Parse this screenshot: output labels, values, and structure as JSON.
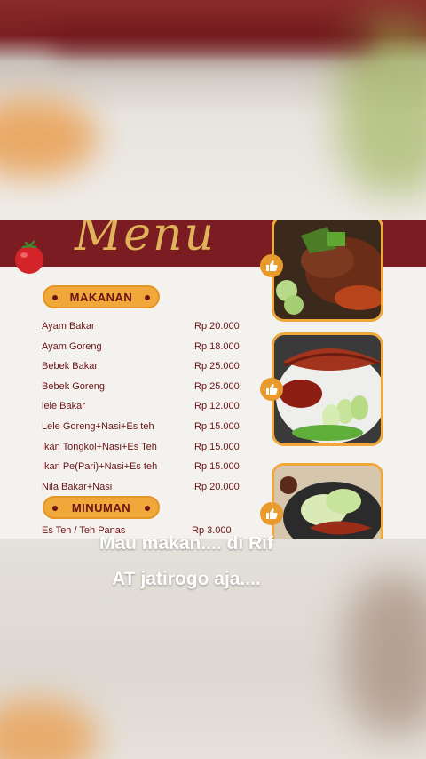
{
  "menu": {
    "title": "Menu",
    "sections": {
      "makanan": "MAKANAN",
      "minuman": "MINUMAN"
    },
    "makanan_items": [
      {
        "name": "Ayam Bakar",
        "price": "Rp 20.000"
      },
      {
        "name": "Ayam Goreng",
        "price": "Rp 18.000"
      },
      {
        "name": "Bebek Bakar",
        "price": "Rp 25.000"
      },
      {
        "name": "Bebek Goreng",
        "price": "Rp 25.000"
      },
      {
        "name": "lele Bakar",
        "price": "Rp 12.000"
      },
      {
        "name": "Lele Goreng+Nasi+Es teh",
        "price": "Rp 15.000"
      },
      {
        "name": "Ikan Tongkol+Nasi+Es Teh",
        "price": "Rp 15.000"
      },
      {
        "name": "Ikan Pe(Pari)+Nasi+Es teh",
        "price": "Rp 15.000"
      },
      {
        "name": "Nila Bakar+Nasi",
        "price": "Rp 20.000"
      }
    ],
    "minuman_items": [
      {
        "name": "Es Teh / Teh Panas",
        "price": "Rp 3.000"
      }
    ]
  },
  "caption": {
    "line1": "Mau makan.... di Rif",
    "line2": "AT jatirogo aja...."
  },
  "icons": {
    "decoration": "tomato-icon",
    "photo_badge": "thumbs-up-icon"
  },
  "colors": {
    "maroon": "#7a1c22",
    "orange": "#f0a83a",
    "gold": "#e0b25a"
  }
}
